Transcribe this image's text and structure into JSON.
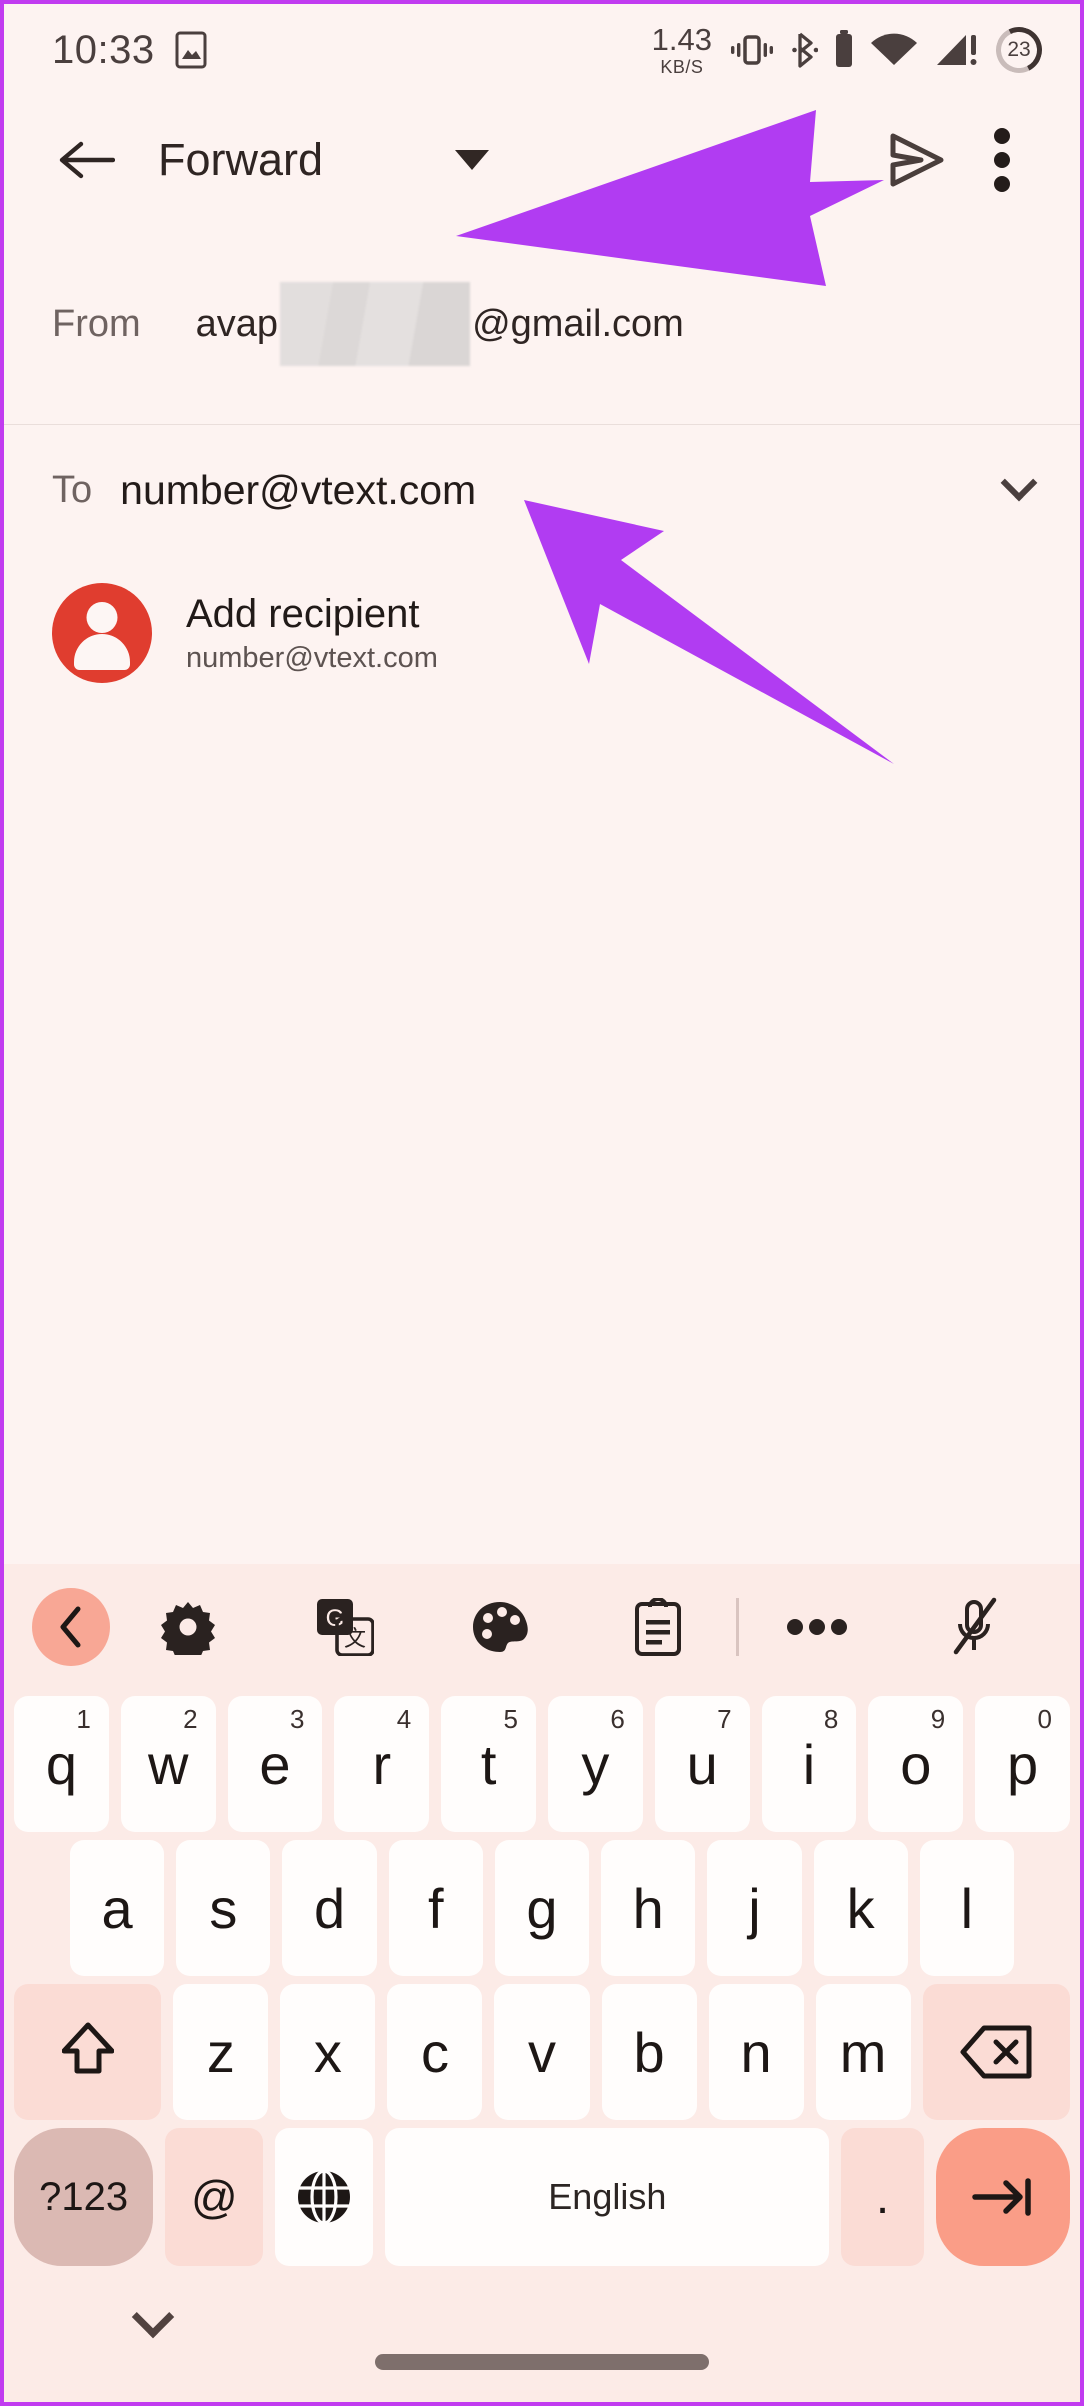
{
  "status_bar": {
    "clock": "10:33",
    "screenshot_icon": "image-icon",
    "network_speed_value": "1.43",
    "network_speed_unit": "KB/S",
    "icons": [
      "vibrate-icon",
      "bluetooth-icon",
      "bluetooth-battery-icon",
      "wifi-icon",
      "cellular-signal-warning-icon"
    ],
    "battery_percent": "23"
  },
  "app_bar": {
    "back_label": "back-arrow",
    "title": "Forward",
    "dropdown_icon": "triangle-down-icon",
    "send_label": "send-icon",
    "overflow_label": "more-options-icon"
  },
  "compose": {
    "from_label": "From",
    "from_value_prefix": "avap",
    "from_value_suffix": "@gmail.com",
    "from_redacted": true,
    "to_label": "To",
    "to_value": "number@vtext.com",
    "expand_icon": "chevron-down-icon",
    "suggestion": {
      "name": "Add recipient",
      "email": "number@vtext.com",
      "avatar_icon": "person-avatar-icon",
      "avatar_color": "#e03d2f"
    }
  },
  "annotations": {
    "accent_color": "#b13cf2",
    "arrows": [
      {
        "name": "arrow-to-send-button",
        "target": "send-icon"
      },
      {
        "name": "arrow-to-recipient-field",
        "target": "to-value"
      }
    ]
  },
  "keyboard": {
    "toolbar": [
      {
        "name": "expand-toolbar-icon",
        "label": "chevron-left-icon"
      },
      {
        "name": "settings-icon",
        "label": "gear-icon"
      },
      {
        "name": "translate-icon",
        "label": "google-translate-icon"
      },
      {
        "name": "theme-icon",
        "label": "palette-icon"
      },
      {
        "name": "clipboard-icon",
        "label": "clipboard-icon"
      },
      {
        "name": "divider",
        "label": "divider"
      },
      {
        "name": "more-icon",
        "label": "three-dots-icon"
      },
      {
        "name": "mic-off-icon",
        "label": "microphone-muted-icon"
      }
    ],
    "row1": [
      {
        "k": "q",
        "n": "1"
      },
      {
        "k": "w",
        "n": "2"
      },
      {
        "k": "e",
        "n": "3"
      },
      {
        "k": "r",
        "n": "4"
      },
      {
        "k": "t",
        "n": "5"
      },
      {
        "k": "y",
        "n": "6"
      },
      {
        "k": "u",
        "n": "7"
      },
      {
        "k": "i",
        "n": "8"
      },
      {
        "k": "o",
        "n": "9"
      },
      {
        "k": "p",
        "n": "0"
      }
    ],
    "row2": [
      "a",
      "s",
      "d",
      "f",
      "g",
      "h",
      "j",
      "k",
      "l"
    ],
    "row3": {
      "shift": "shift-icon",
      "keys": [
        "z",
        "x",
        "c",
        "v",
        "b",
        "n",
        "m"
      ],
      "backspace": "backspace-icon"
    },
    "row4": {
      "symbols": "?123",
      "at": "@",
      "globe": "globe-icon",
      "space": "English",
      "period": ".",
      "enter": "next-field-icon"
    },
    "hide_icon": "chevron-down-icon",
    "home_indicator": "home-gesture-bar"
  }
}
